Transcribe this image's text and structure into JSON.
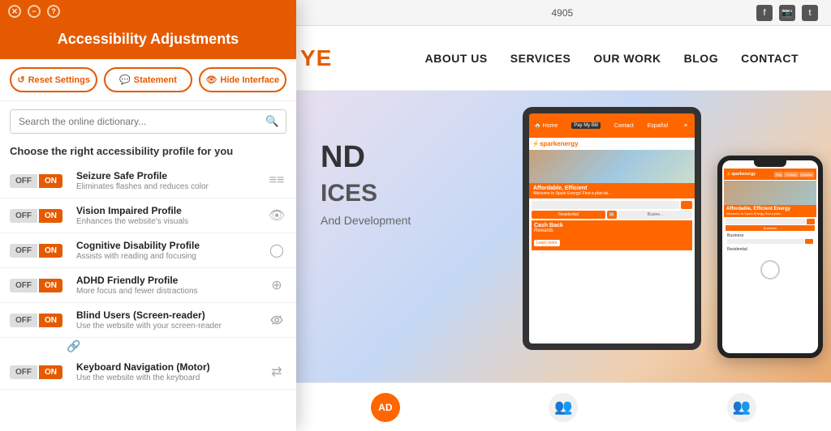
{
  "website": {
    "phone": "4905",
    "logo": "YE",
    "nav": {
      "links": [
        "ABOUT US",
        "SERVICES",
        "OUR WORK",
        "BLOG",
        "CONTACT"
      ]
    },
    "hero": {
      "line1": "ND",
      "line2": "ICES",
      "subtitle": "And Development"
    },
    "bottom_icons": [
      {
        "label": "AD",
        "color": "#ff6600"
      },
      {
        "label": "👥",
        "color": "#555"
      },
      {
        "label": "👥",
        "color": "#555"
      }
    ]
  },
  "accessibility": {
    "title": "Accessibility Adjustments",
    "buttons": {
      "reset": "Reset Settings",
      "statement": "Statement",
      "hide": "Hide Interface"
    },
    "search_placeholder": "Search the online dictionary...",
    "subtitle": "Choose the right accessibility profile for you",
    "profiles": [
      {
        "name": "Seizure Safe Profile",
        "desc": "Eliminates flashes and reduces color",
        "icon": "≡≡"
      },
      {
        "name": "Vision Impaired Profile",
        "desc": "Enhances the website's visuals",
        "icon": "👁"
      },
      {
        "name": "Cognitive Disability Profile",
        "desc": "Assists with reading and focusing",
        "icon": "◯"
      },
      {
        "name": "ADHD Friendly Profile",
        "desc": "More focus and fewer distractions",
        "icon": "⊕"
      },
      {
        "name": "Blind Users (Screen-reader)",
        "desc": "Use the website with your screen-reader",
        "icon": "⚙"
      },
      {
        "name": "Keyboard Navigation (Motor)",
        "desc": "Use the website with the keyboard",
        "icon": "⇄"
      }
    ],
    "toggle_off_label": "OFF",
    "toggle_on_label": "ON"
  }
}
